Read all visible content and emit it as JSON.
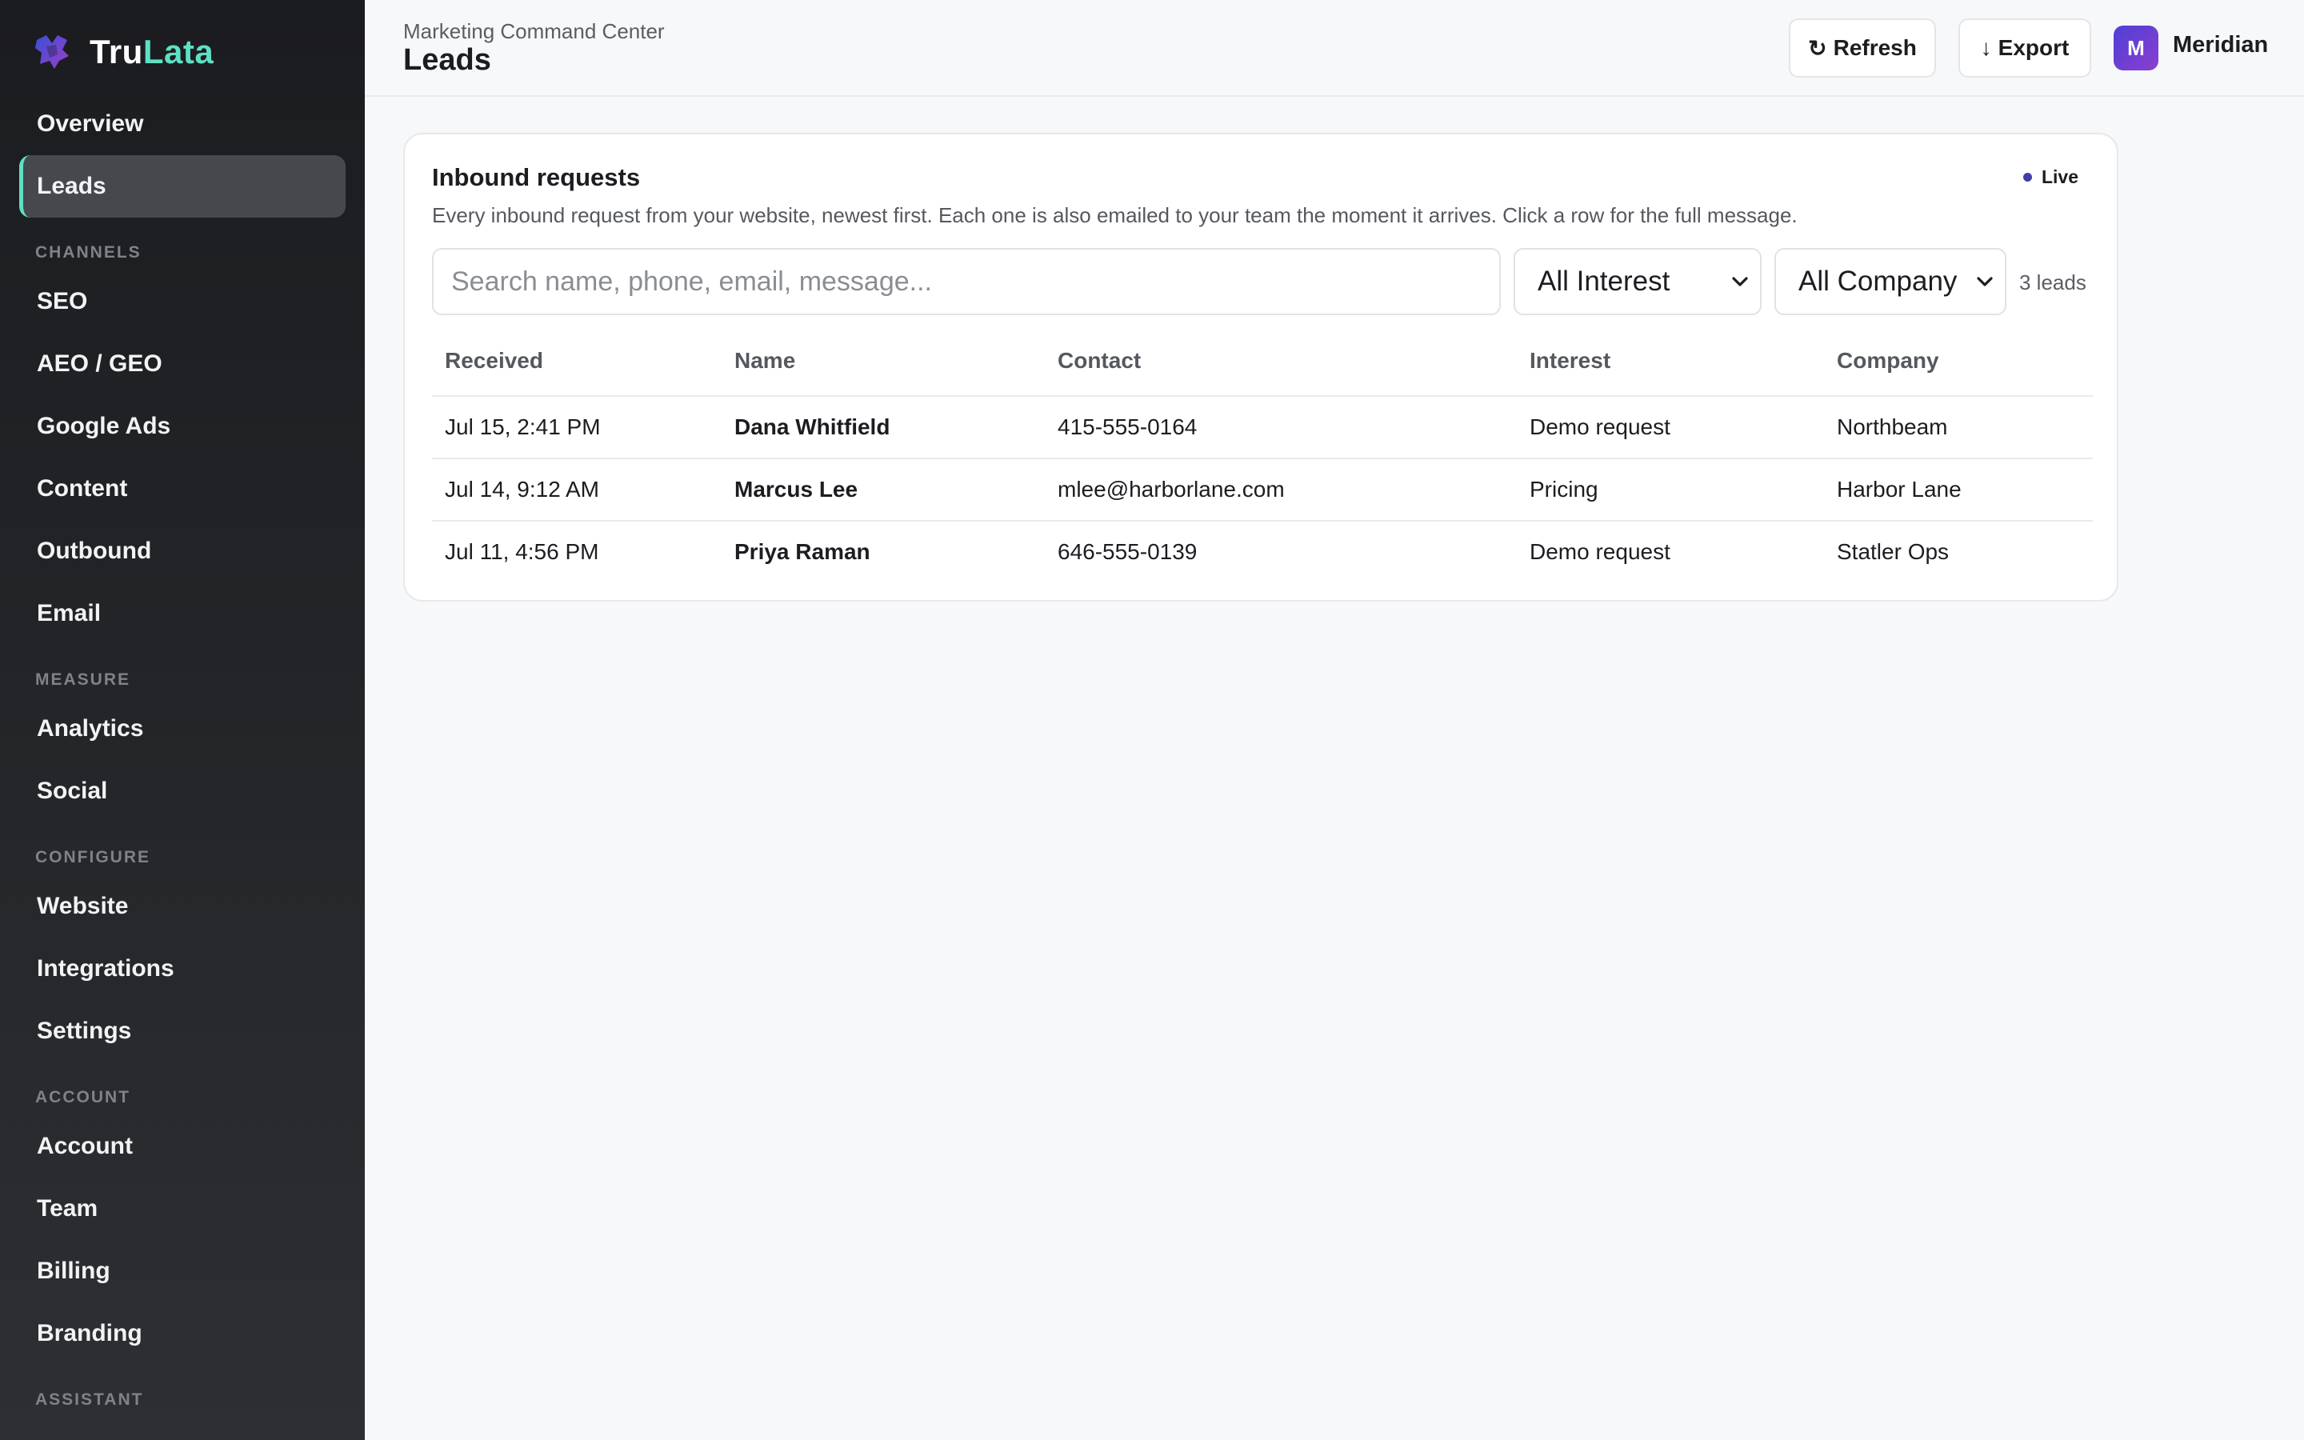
{
  "brand": {
    "name_part1": "Tru",
    "name_part2": "Lata",
    "accent_color": "#5ee0c4"
  },
  "sidebar": {
    "items": [
      {
        "type": "item",
        "label": "Overview"
      },
      {
        "type": "item",
        "label": "Leads",
        "active": true
      },
      {
        "type": "section",
        "label": "CHANNELS"
      },
      {
        "type": "item",
        "label": "SEO"
      },
      {
        "type": "item",
        "label": "AEO / GEO"
      },
      {
        "type": "item",
        "label": "Google Ads"
      },
      {
        "type": "item",
        "label": "Content"
      },
      {
        "type": "item",
        "label": "Outbound"
      },
      {
        "type": "item",
        "label": "Email"
      },
      {
        "type": "section",
        "label": "MEASURE"
      },
      {
        "type": "item",
        "label": "Analytics"
      },
      {
        "type": "item",
        "label": "Social"
      },
      {
        "type": "section",
        "label": "CONFIGURE"
      },
      {
        "type": "item",
        "label": "Website"
      },
      {
        "type": "item",
        "label": "Integrations"
      },
      {
        "type": "item",
        "label": "Settings"
      },
      {
        "type": "section",
        "label": "ACCOUNT"
      },
      {
        "type": "item",
        "label": "Account"
      },
      {
        "type": "item",
        "label": "Team"
      },
      {
        "type": "item",
        "label": "Billing"
      },
      {
        "type": "item",
        "label": "Branding"
      },
      {
        "type": "section",
        "label": "ASSISTANT"
      }
    ]
  },
  "header": {
    "breadcrumb": "Marketing Command Center",
    "title": "Leads",
    "refresh_label": "Refresh",
    "refresh_icon": "↻",
    "export_label": "Export",
    "export_icon": "↓",
    "avatar_initial": "M",
    "account_name": "Meridian"
  },
  "card": {
    "title": "Inbound requests",
    "live_label": "Live",
    "live_color": "#3f3fa8",
    "description": "Every inbound request from your website, newest first. Each one is also emailed to your team the moment it arrives. Click a row for the full message.",
    "search_placeholder": "Search name, phone, email, message...",
    "interest_filter": "All Interest",
    "company_filter": "All Company",
    "lead_count": "3 leads"
  },
  "table": {
    "headers": {
      "received": "Received",
      "name": "Name",
      "contact": "Contact",
      "interest": "Interest",
      "company": "Company"
    },
    "rows": [
      {
        "received": "Jul 15, 2:41 PM",
        "name": "Dana Whitfield",
        "contact": "415-555-0164",
        "interest": "Demo request",
        "company": "Northbeam"
      },
      {
        "received": "Jul 14, 9:12 AM",
        "name": "Marcus Lee",
        "contact": "mlee@harborlane.com",
        "interest": "Pricing",
        "company": "Harbor Lane"
      },
      {
        "received": "Jul 11, 4:56 PM",
        "name": "Priya Raman",
        "contact": "646-555-0139",
        "interest": "Demo request",
        "company": "Statler Ops"
      }
    ]
  }
}
